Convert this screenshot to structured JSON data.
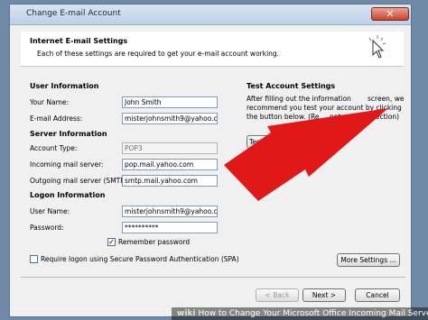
{
  "window": {
    "title": "Change E-mail Account",
    "close_glyph": "✕"
  },
  "header": {
    "title": "Internet E-mail Settings",
    "subtitle": "Each of these settings are required to get your e-mail account working."
  },
  "user_info": {
    "heading": "User Information",
    "name_label": "Your Name:",
    "name_value": "John Smith",
    "email_label": "E-mail Address:",
    "email_value": "misterjohnsmith9@yahoo.com"
  },
  "server_info": {
    "heading": "Server Information",
    "account_type_label": "Account Type:",
    "account_type_value": "POP3",
    "incoming_label": "Incoming mail server:",
    "incoming_value": "pop.mail.yahoo.com",
    "outgoing_label": "Outgoing mail server (SMTP):",
    "outgoing_value": "smtp.mail.yahoo.com"
  },
  "logon_info": {
    "heading": "Logon Information",
    "username_label": "User Name:",
    "username_value": "misterjohnsmith9@yahoo.com",
    "password_label": "Password:",
    "password_value": "**********",
    "remember_label": "Remember password",
    "remember_checked": true,
    "remember_glyph": "✓",
    "spa_label": "Require logon using Secure Password Authentication (SPA)",
    "spa_checked": false
  },
  "test_settings": {
    "heading": "Test Account Settings",
    "desc_line1": "After filling out the information",
    "desc_line1_end": "screen, we",
    "desc_line2": "recommend you test your account by clicking",
    "desc_line3": "the button below. (Re",
    "desc_line3_end": "network connection)",
    "test_button": "Test Account Settings ..."
  },
  "buttons": {
    "more_settings": "More Settings ...",
    "back": "< Back",
    "next": "Next >",
    "cancel": "Cancel"
  },
  "caption": {
    "brand": "wiki",
    "text": "How to Change Your Microsoft Office Incoming Mail Server"
  },
  "annotation": {
    "arrow_color": "#e01818"
  }
}
